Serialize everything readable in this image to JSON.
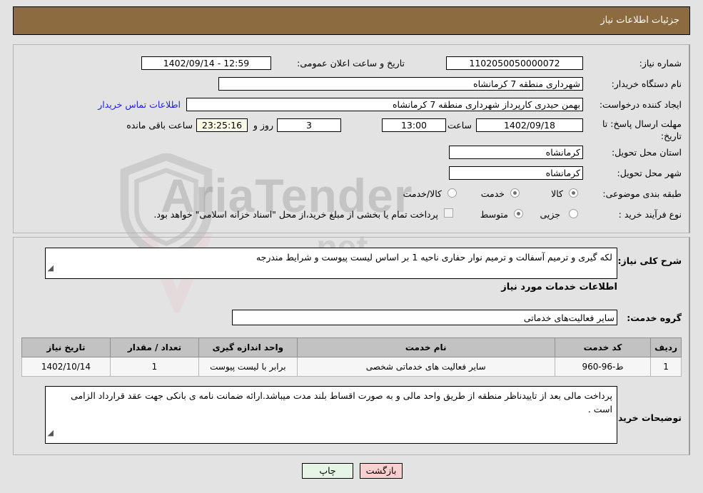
{
  "header": {
    "title": "جزئیات اطلاعات نیاز",
    "bg_color": "#8d6b41"
  },
  "watermark": {
    "text": "AriaTender",
    "suffix": ".net",
    "brand": "artatender.net"
  },
  "form": {
    "need_number": {
      "label": "شماره نیاز:",
      "value": "1102050050000072"
    },
    "buyer_org": {
      "label": "نام دستگاه خریدار:",
      "value": "شهرداری منطقه 7 کرمانشاه"
    },
    "request_creator": {
      "label": "ایجاد کننده درخواست:",
      "value": "بهمن حیدری کارپرداز شهرداری منطقه 7 کرمانشاه"
    },
    "public_announce": {
      "label": "تاریخ و ساعت اعلان عمومی:",
      "value": "12:59 - 1402/09/14"
    },
    "contact_link": {
      "label": "اطلاعات تماس خریدار"
    },
    "reply_deadline": {
      "label": "مهلت ارسال پاسخ: تا تاریخ:",
      "date": "1402/09/18",
      "time_label": "ساعت",
      "time": "13:00",
      "days": "3",
      "days_label": "روز و",
      "countdown": "23:25:16",
      "countdown_label": "ساعت باقی مانده"
    },
    "delivery_province": {
      "label": "استان محل تحویل:",
      "value": "کرمانشاه"
    },
    "delivery_city": {
      "label": "شهر محل تحویل:",
      "value": "کرمانشاه"
    },
    "subject_class": {
      "label": "طبقه بندی موضوعی:",
      "options": [
        {
          "label": "کالا",
          "selected": false
        },
        {
          "label": "خدمت",
          "selected": true
        },
        {
          "label": "کالا/خدمت",
          "selected": false
        }
      ]
    },
    "purchase_type": {
      "label": "نوع فرآیند خرید :",
      "options": [
        {
          "label": "جزیی",
          "selected": false
        },
        {
          "label": "متوسط",
          "selected": true
        }
      ],
      "checkbox_note": "پرداخت تمام یا بخشی از مبلغ خرید،از محل \"اسناد خزانه اسلامی\" خواهد بود.",
      "checkbox_checked": false
    }
  },
  "need_description": {
    "label": "شرح کلی نیاز:",
    "value": "لکه گیری و ترمیم آسفالت و ترمیم نوار حفاری ناحیه 1 بر اساس لیست پیوست و شرایط مندرجه"
  },
  "services_section": {
    "heading": "اطلاعات خدمات مورد نیاز",
    "service_group": {
      "label": "گروه خدمت:",
      "value": "سایر فعالیت‌های خدماتی"
    },
    "table": {
      "columns": [
        "ردیف",
        "کد خدمت",
        "نام خدمت",
        "واحد اندازه گیری",
        "تعداد / مقدار",
        "تاریخ نیاز"
      ],
      "rows": [
        {
          "index": "1",
          "service_code": "ط-96-960",
          "service_name": "سایر فعالیت های خدماتی شخصی",
          "unit": "برابر با لیست پیوست",
          "quantity": "1",
          "need_date": "1402/10/14"
        }
      ]
    }
  },
  "buyer_notes": {
    "label": "توضیحات خریدار:",
    "value": "پرداخت مالی بعد از تاییدناظر منطقه از طریق واحد مالی و به صورت اقساط بلند مدت میباشد.ارائه ضمانت نامه ی بانکی جهت عقد قرارداد الزامی است ."
  },
  "footer": {
    "print_button": "چاپ",
    "back_button": "بازگشت"
  }
}
